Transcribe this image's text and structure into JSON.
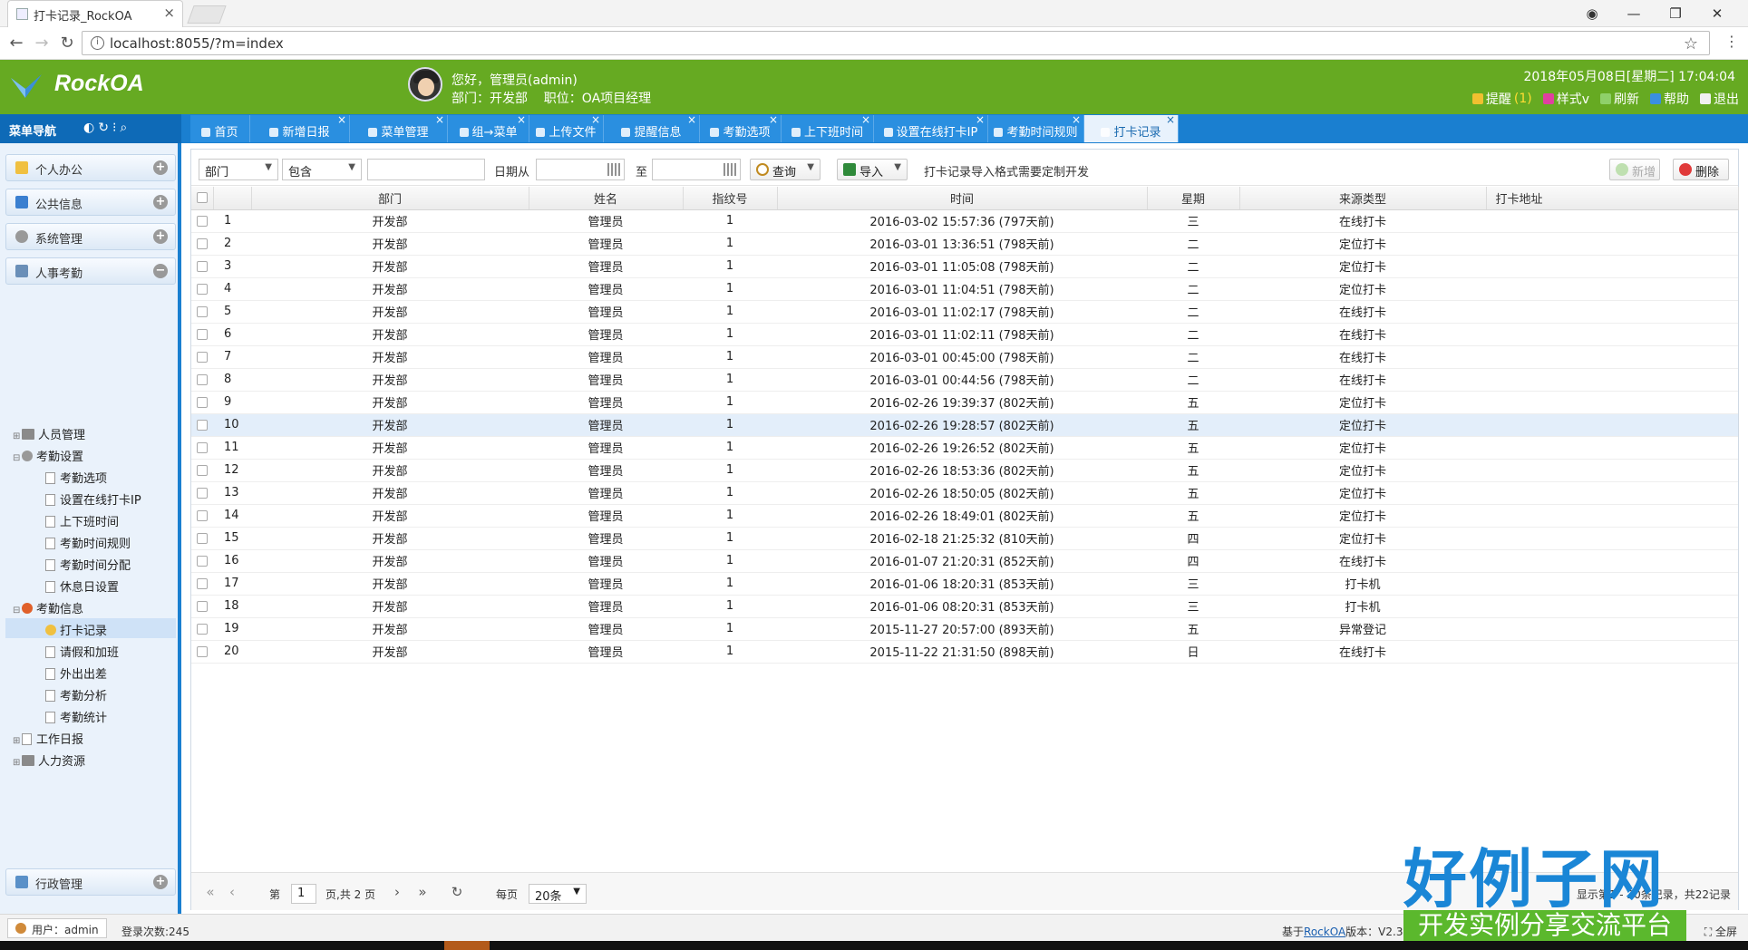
{
  "browser": {
    "tab_title": "打卡记录_RockOA",
    "url": "localhost:8055/?m=index"
  },
  "header": {
    "logo": "RockOA",
    "greeting": "您好，管理员(admin)",
    "dept_line": "部门：开发部    职位：OA项目经理",
    "datetime": "2018年05月08日[星期二] 17:04:04",
    "actions": [
      {
        "label": "提醒",
        "badge": "(1)",
        "icon": "bell-icon",
        "color": "#f0c030"
      },
      {
        "label": "样式v",
        "icon": "palette-icon",
        "color": "#e040a0"
      },
      {
        "label": "刷新",
        "icon": "refresh-icon",
        "color": "#8fd06a"
      },
      {
        "label": "帮助",
        "icon": "help-icon",
        "color": "#3a8fe0"
      },
      {
        "label": "退出",
        "icon": "logout-icon",
        "color": "#f0f0f0"
      }
    ]
  },
  "sidebar": {
    "title": "菜单导航",
    "groups": [
      {
        "label": "个人办公",
        "toggle": "+"
      },
      {
        "label": "公共信息",
        "toggle": "+"
      },
      {
        "label": "系统管理",
        "toggle": "+"
      },
      {
        "label": "人事考勤",
        "toggle": "−"
      }
    ],
    "bottom_group": {
      "label": "行政管理",
      "toggle": "+"
    },
    "tree": [
      {
        "label": "人员管理",
        "level": 0,
        "kind": "folder",
        "twist": "+"
      },
      {
        "label": "考勤设置",
        "level": 0,
        "kind": "gear",
        "twist": "−"
      },
      {
        "label": "考勤选项",
        "level": 1,
        "kind": "page"
      },
      {
        "label": "设置在线打卡IP",
        "level": 1,
        "kind": "page"
      },
      {
        "label": "上下班时间",
        "level": 1,
        "kind": "page"
      },
      {
        "label": "考勤时间规则",
        "level": 1,
        "kind": "page"
      },
      {
        "label": "考勤时间分配",
        "level": 1,
        "kind": "page"
      },
      {
        "label": "休息日设置",
        "level": 1,
        "kind": "page"
      },
      {
        "label": "考勤信息",
        "level": 0,
        "kind": "info",
        "twist": "−"
      },
      {
        "label": "打卡记录",
        "level": 1,
        "kind": "clock",
        "selected": true
      },
      {
        "label": "请假和加班",
        "level": 1,
        "kind": "page"
      },
      {
        "label": "外出出差",
        "level": 1,
        "kind": "page"
      },
      {
        "label": "考勤分析",
        "level": 1,
        "kind": "page"
      },
      {
        "label": "考勤统计",
        "level": 1,
        "kind": "page"
      },
      {
        "label": "工作日报",
        "level": 0,
        "kind": "page",
        "twist": "+"
      },
      {
        "label": "人力资源",
        "level": 0,
        "kind": "folder",
        "twist": "+"
      }
    ]
  },
  "tabs": [
    {
      "label": "首页"
    },
    {
      "label": "新增日报"
    },
    {
      "label": "菜单管理"
    },
    {
      "label": "组→菜单"
    },
    {
      "label": "上传文件"
    },
    {
      "label": "提醒信息"
    },
    {
      "label": "考勤选项"
    },
    {
      "label": "上下班时间"
    },
    {
      "label": "设置在线打卡IP"
    },
    {
      "label": "考勤时间规则"
    },
    {
      "label": "打卡记录",
      "active": true
    }
  ],
  "toolbar": {
    "field_select": "部门",
    "op_select": "包含",
    "keyword": "",
    "date_from_label": "日期从",
    "date_from": "",
    "date_to_label": "至",
    "date_to": "",
    "query_label": "查询",
    "import_label": "导入",
    "hint": "打卡记录导入格式需要定制开发",
    "add_label": "新增",
    "delete_label": "删除"
  },
  "table": {
    "headers": [
      "部门",
      "姓名",
      "指纹号",
      "时间",
      "星期",
      "来源类型",
      "打卡地址"
    ],
    "rows": [
      {
        "n": "1",
        "dept": "开发部",
        "name": "管理员",
        "fp": "1",
        "time": "2016-03-02 15:57:36 (797天前)",
        "week": "三",
        "src": "在线打卡",
        "addr": ""
      },
      {
        "n": "2",
        "dept": "开发部",
        "name": "管理员",
        "fp": "1",
        "time": "2016-03-01 13:36:51 (798天前)",
        "week": "二",
        "src": "定位打卡",
        "addr": ""
      },
      {
        "n": "3",
        "dept": "开发部",
        "name": "管理员",
        "fp": "1",
        "time": "2016-03-01 11:05:08 (798天前)",
        "week": "二",
        "src": "定位打卡",
        "addr": ""
      },
      {
        "n": "4",
        "dept": "开发部",
        "name": "管理员",
        "fp": "1",
        "time": "2016-03-01 11:04:51 (798天前)",
        "week": "二",
        "src": "定位打卡",
        "addr": ""
      },
      {
        "n": "5",
        "dept": "开发部",
        "name": "管理员",
        "fp": "1",
        "time": "2016-03-01 11:02:17 (798天前)",
        "week": "二",
        "src": "在线打卡",
        "addr": ""
      },
      {
        "n": "6",
        "dept": "开发部",
        "name": "管理员",
        "fp": "1",
        "time": "2016-03-01 11:02:11 (798天前)",
        "week": "二",
        "src": "在线打卡",
        "addr": ""
      },
      {
        "n": "7",
        "dept": "开发部",
        "name": "管理员",
        "fp": "1",
        "time": "2016-03-01 00:45:00 (798天前)",
        "week": "二",
        "src": "在线打卡",
        "addr": ""
      },
      {
        "n": "8",
        "dept": "开发部",
        "name": "管理员",
        "fp": "1",
        "time": "2016-03-01 00:44:56 (798天前)",
        "week": "二",
        "src": "在线打卡",
        "addr": ""
      },
      {
        "n": "9",
        "dept": "开发部",
        "name": "管理员",
        "fp": "1",
        "time": "2016-02-26 19:39:37 (802天前)",
        "week": "五",
        "src": "定位打卡",
        "addr": ""
      },
      {
        "n": "10",
        "dept": "开发部",
        "name": "管理员",
        "fp": "1",
        "time": "2016-02-26 19:28:57 (802天前)",
        "week": "五",
        "src": "定位打卡",
        "addr": "",
        "highlight": true
      },
      {
        "n": "11",
        "dept": "开发部",
        "name": "管理员",
        "fp": "1",
        "time": "2016-02-26 19:26:52 (802天前)",
        "week": "五",
        "src": "定位打卡",
        "addr": ""
      },
      {
        "n": "12",
        "dept": "开发部",
        "name": "管理员",
        "fp": "1",
        "time": "2016-02-26 18:53:36 (802天前)",
        "week": "五",
        "src": "定位打卡",
        "addr": ""
      },
      {
        "n": "13",
        "dept": "开发部",
        "name": "管理员",
        "fp": "1",
        "time": "2016-02-26 18:50:05 (802天前)",
        "week": "五",
        "src": "定位打卡",
        "addr": ""
      },
      {
        "n": "14",
        "dept": "开发部",
        "name": "管理员",
        "fp": "1",
        "time": "2016-02-26 18:49:01 (802天前)",
        "week": "五",
        "src": "定位打卡",
        "addr": ""
      },
      {
        "n": "15",
        "dept": "开发部",
        "name": "管理员",
        "fp": "1",
        "time": "2016-02-18 21:25:32 (810天前)",
        "week": "四",
        "src": "定位打卡",
        "addr": ""
      },
      {
        "n": "16",
        "dept": "开发部",
        "name": "管理员",
        "fp": "1",
        "time": "2016-01-07 21:20:31 (852天前)",
        "week": "四",
        "src": "在线打卡",
        "addr": ""
      },
      {
        "n": "17",
        "dept": "开发部",
        "name": "管理员",
        "fp": "1",
        "time": "2016-01-06 18:20:31 (853天前)",
        "week": "三",
        "src": "打卡机",
        "addr": ""
      },
      {
        "n": "18",
        "dept": "开发部",
        "name": "管理员",
        "fp": "1",
        "time": "2016-01-06 08:20:31 (853天前)",
        "week": "三",
        "src": "打卡机",
        "addr": ""
      },
      {
        "n": "19",
        "dept": "开发部",
        "name": "管理员",
        "fp": "1",
        "time": "2015-11-27 20:57:00 (893天前)",
        "week": "五",
        "src": "异常登记",
        "addr": ""
      },
      {
        "n": "20",
        "dept": "开发部",
        "name": "管理员",
        "fp": "1",
        "time": "2015-11-22 21:31:50 (898天前)",
        "week": "日",
        "src": "在线打卡",
        "addr": ""
      }
    ]
  },
  "pager": {
    "page_label": "第",
    "page": "1",
    "of_label": "页,共 2 页",
    "per_label": "每页",
    "per_page": "20条",
    "summary": "显示第1 - 20条记录，共22记录"
  },
  "statusbar": {
    "user": "用户：admin",
    "logins": "登录次数:245",
    "version_prefix": "基于",
    "version_link": "RockOA",
    "version_suffix": "版本：V2.3.2",
    "fullscreen": "全屏"
  },
  "stamp": {
    "big": "好例子网",
    "small": "开发实例分享交流平台"
  }
}
